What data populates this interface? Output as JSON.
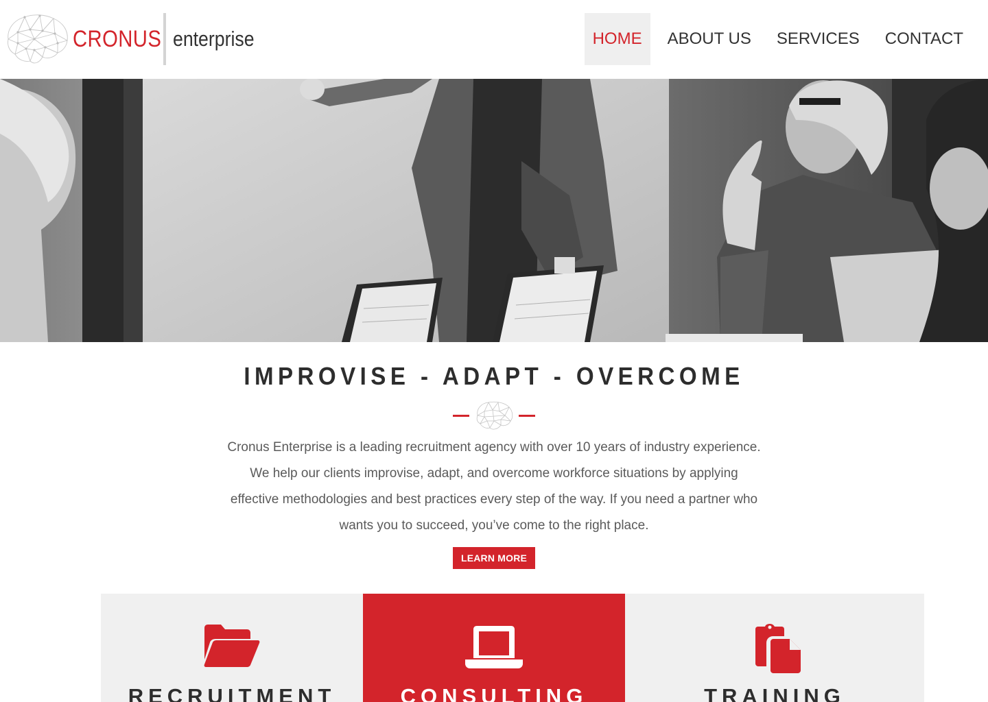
{
  "brand": {
    "name": "CRONUS",
    "tagline": "enterprise",
    "accent_color": "#d3242b"
  },
  "nav": {
    "items": [
      {
        "label": "HOME",
        "active": true
      },
      {
        "label": "ABOUT US",
        "active": false
      },
      {
        "label": "SERVICES",
        "active": false
      },
      {
        "label": "CONTACT",
        "active": false
      }
    ]
  },
  "hero": {
    "image": "black-and-white office meeting photo"
  },
  "intro": {
    "headline": "IMPROVISE - ADAPT - OVERCOME",
    "body": "Cronus Enterprise is a leading recruitment agency with over 10 years of industry experience.  We help our clients improvise, adapt, and overcome workforce situations by applying effective methodologies and best practices every step of the way.  If you need a partner who wants you to succeed, you’ve come to the right place.",
    "cta_label": "LEARN MORE"
  },
  "services": [
    {
      "title": "RECRUITMENT",
      "icon": "folder-open-icon"
    },
    {
      "title": "CONSULTING",
      "icon": "laptop-icon"
    },
    {
      "title": "TRAINING",
      "icon": "clipboard-copy-icon"
    }
  ]
}
